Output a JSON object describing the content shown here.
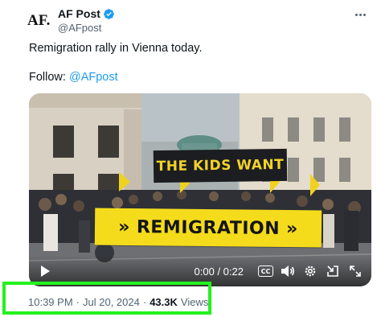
{
  "author": {
    "avatar_text": "AF.",
    "name": "AF Post",
    "handle": "@AFpost"
  },
  "tweet": {
    "line1": "Remigration rally in Vienna today.",
    "follow_label": "Follow:",
    "follow_mention": "@AFpost"
  },
  "video": {
    "banner_top": "THE KIDS WANT",
    "banner_main": "REMIGRATION",
    "time": "0:00 / 0:22",
    "cc_label": "CC"
  },
  "meta": {
    "time": "10:39 PM",
    "separator": "·",
    "date": "Jul 20, 2024",
    "views_count": "43.3K",
    "views_label": "Views"
  },
  "colors": {
    "accent": "#1d9bf0",
    "highlight": "#23f21e",
    "banner_yellow": "#f4dc1c"
  }
}
